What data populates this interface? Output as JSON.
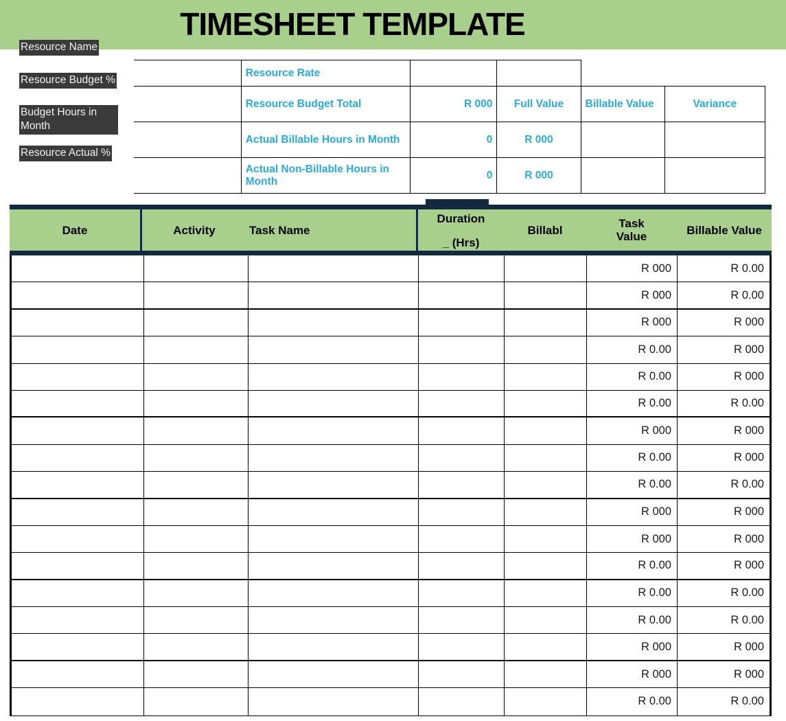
{
  "title": "TIMESHEET TEMPLATE",
  "colors": {
    "banner_green": "#a8cf8b",
    "header_navy": "#12293f",
    "accent_blue": "#29ABE2",
    "label_highlight": "#3a3a3a"
  },
  "left_labels": [
    {
      "text": "Resource Name"
    },
    {
      "text": "Resource Budget %"
    },
    {
      "text": "Budget Hours in Month"
    },
    {
      "text": "Resource Actual %"
    }
  ],
  "info_table": {
    "rows": [
      {
        "blank": "",
        "label": "Resource Rate",
        "value": "",
        "full_value": "",
        "billable_value": "",
        "variance": ""
      },
      {
        "blank": "",
        "label": "Resource Budget Total",
        "value": "R 000",
        "full_value": "Full Value",
        "billable_value": "Billable Value",
        "variance": "Variance"
      },
      {
        "blank": "",
        "label": "Actual Billable Hours in Month",
        "value": "0",
        "full_value": "R 000",
        "billable_value": "",
        "variance": ""
      },
      {
        "blank": "",
        "label": "Actual Non-Billable Hours in Month",
        "value": "0",
        "full_value": "R 000",
        "billable_value": "",
        "variance": ""
      }
    ]
  },
  "timesheet": {
    "columns": [
      {
        "key": "date",
        "label": "Date"
      },
      {
        "key": "activity",
        "label": "Activity"
      },
      {
        "key": "task_name",
        "label": "Task Name"
      },
      {
        "key": "duration",
        "label": "Duration\n (Hrs)"
      },
      {
        "key": "billable",
        "label": "Billabl"
      },
      {
        "key": "task_value",
        "label": "Task\nValue"
      },
      {
        "key": "billable_value",
        "label": "Billable Value"
      }
    ],
    "header_labels": {
      "date": "Date",
      "activity": "Activity",
      "task_name": "Task Name",
      "duration_line1": "Duration",
      "duration_line2": "_ (Hrs)",
      "billable": "Billabl",
      "task_value_line1": "Task",
      "task_value_line2": "Value",
      "billable_value": "Billable Value"
    },
    "rows": [
      {
        "date": "",
        "activity": "",
        "task_name": "",
        "duration": "",
        "billable": "",
        "task_value": "R 000",
        "billable_value": "R 0.00"
      },
      {
        "date": "",
        "activity": "",
        "task_name": "",
        "duration": "",
        "billable": "",
        "task_value": "R 000",
        "billable_value": "R 0.00"
      },
      {
        "date": "",
        "activity": "",
        "task_name": "",
        "duration": "",
        "billable": "",
        "task_value": "R 000",
        "billable_value": "R 000"
      },
      {
        "date": "",
        "activity": "",
        "task_name": "",
        "duration": "",
        "billable": "",
        "task_value": "R 0.00",
        "billable_value": "R 000"
      },
      {
        "date": "",
        "activity": "",
        "task_name": "",
        "duration": "",
        "billable": "",
        "task_value": "R 0.00",
        "billable_value": "R 000"
      },
      {
        "date": "",
        "activity": "",
        "task_name": "",
        "duration": "",
        "billable": "",
        "task_value": "R 0.00",
        "billable_value": "R 0.00"
      },
      {
        "date": "",
        "activity": "",
        "task_name": "",
        "duration": "",
        "billable": "",
        "task_value": "R 000",
        "billable_value": "R 000"
      },
      {
        "date": "",
        "activity": "",
        "task_name": "",
        "duration": "",
        "billable": "",
        "task_value": "R 0.00",
        "billable_value": "R 000"
      },
      {
        "date": "",
        "activity": "",
        "task_name": "",
        "duration": "",
        "billable": "",
        "task_value": "R 0.00",
        "billable_value": "R 0.00"
      },
      {
        "date": "",
        "activity": "",
        "task_name": "",
        "duration": "",
        "billable": "",
        "task_value": "R 000",
        "billable_value": "R 000"
      },
      {
        "date": "",
        "activity": "",
        "task_name": "",
        "duration": "",
        "billable": "",
        "task_value": "R 000",
        "billable_value": "R 000"
      },
      {
        "date": "",
        "activity": "",
        "task_name": "",
        "duration": "",
        "billable": "",
        "task_value": "R 0.00",
        "billable_value": "R 000"
      },
      {
        "date": "",
        "activity": "",
        "task_name": "",
        "duration": "",
        "billable": "",
        "task_value": "R 0.00",
        "billable_value": "R 0.00"
      },
      {
        "date": "",
        "activity": "",
        "task_name": "",
        "duration": "",
        "billable": "",
        "task_value": "R 0.00",
        "billable_value": "R 0.00"
      },
      {
        "date": "",
        "activity": "",
        "task_name": "",
        "duration": "",
        "billable": "",
        "task_value": "R 000",
        "billable_value": "R 000"
      },
      {
        "date": "",
        "activity": "",
        "task_name": "",
        "duration": "",
        "billable": "",
        "task_value": "R 000",
        "billable_value": "R 000"
      },
      {
        "date": "",
        "activity": "",
        "task_name": "",
        "duration": "",
        "billable": "",
        "task_value": "R 0.00",
        "billable_value": "R 0.00"
      }
    ],
    "group_break_after_rows": [
      1,
      5,
      8,
      11,
      14,
      16
    ]
  }
}
